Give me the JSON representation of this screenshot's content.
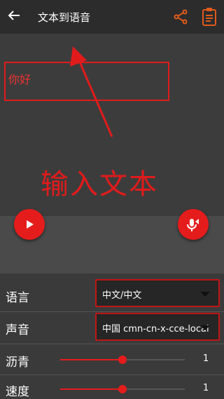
{
  "appbar": {
    "title": "文本到语音"
  },
  "editor": {
    "text": "你好",
    "annotation": "输入文本"
  },
  "settings": {
    "language": {
      "label": "语言",
      "value": "中文/中文"
    },
    "voice": {
      "label": "声音",
      "value": "中国 cmn-cn-x-cce-local"
    },
    "pitch": {
      "label": "沥青",
      "value": "1",
      "fraction": 0.5
    },
    "speed": {
      "label": "速度",
      "value": "1",
      "fraction": 0.5
    }
  },
  "icons": [
    "back-arrow-icon",
    "share-icon",
    "clipboard-icon",
    "play-icon",
    "mic-icon",
    "dropdown-caret-icon"
  ],
  "colors": {
    "accent": "#e51c1c",
    "appbar": "#2c2c2c",
    "background": "#3a3a3a"
  }
}
